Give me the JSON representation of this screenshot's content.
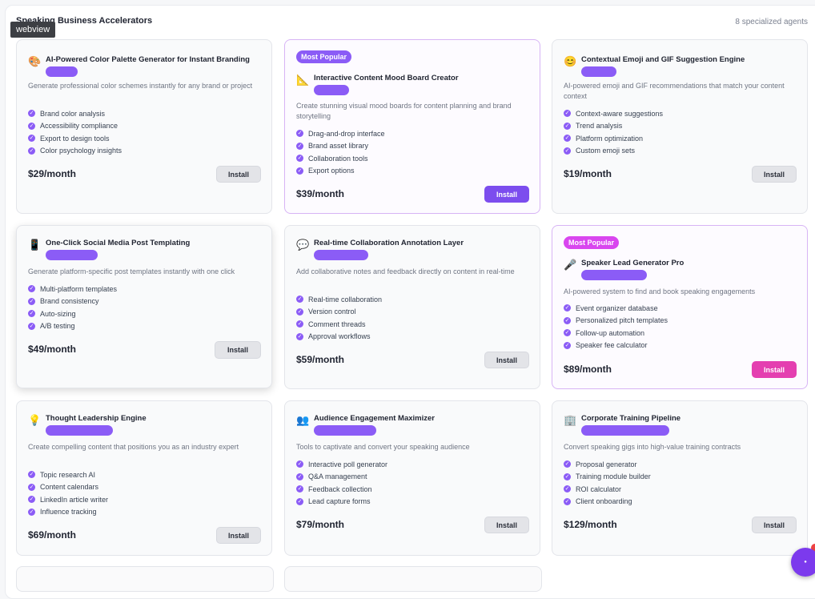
{
  "section": {
    "title": "Speaking Business Accelerators",
    "count": "8 specialized agents"
  },
  "webview_label": "webview",
  "badge_text": "Most Popular",
  "install_label": "Install",
  "colors": {
    "accent": "#8b5cf6",
    "pink": "#e43fb0",
    "purple_button": "#7c4dee"
  },
  "cards": [
    {
      "title": "AI-Powered Color Palette Generator for Instant Branding",
      "icon": "palette-icon",
      "glyph": "🎨",
      "desc": "Generate professional color schemes instantly for any brand or project",
      "features": [
        "Brand color analysis",
        "Accessibility compliance",
        "Export to design tools",
        "Color psychology insights"
      ],
      "price": "$29/month"
    },
    {
      "title": "Interactive Content Mood Board Creator",
      "icon": "triangle-ruler-icon",
      "glyph": "📐",
      "desc": "Create stunning visual mood boards for content planning and brand storytelling",
      "features": [
        "Drag-and-drop interface",
        "Brand asset library",
        "Collaboration tools",
        "Export options"
      ],
      "price": "$39/month"
    },
    {
      "title": "Contextual Emoji and GIF Suggestion Engine",
      "icon": "smiley-icon",
      "glyph": "😊",
      "desc": "AI-powered emoji and GIF recommendations that match your content context",
      "features": [
        "Context-aware suggestions",
        "Trend analysis",
        "Platform optimization",
        "Custom emoji sets"
      ],
      "price": "$19/month"
    },
    {
      "title": "One-Click Social Media Post Templating",
      "icon": "phone-icon",
      "glyph": "📱",
      "desc": "Generate platform-specific post templates instantly with one click",
      "features": [
        "Multi-platform templates",
        "Brand consistency",
        "Auto-sizing",
        "A/B testing"
      ],
      "price": "$49/month"
    },
    {
      "title": "Real-time Collaboration Annotation Layer",
      "icon": "speech-bubble-icon",
      "glyph": "💬",
      "desc": "Add collaborative notes and feedback directly on content in real-time",
      "features": [
        "Real-time collaboration",
        "Version control",
        "Comment threads",
        "Approval workflows"
      ],
      "price": "$59/month"
    },
    {
      "title": "Speaker Lead Generator Pro",
      "icon": "microphone-icon",
      "glyph": "🎤",
      "desc": "AI-powered system to find and book speaking engagements",
      "features": [
        "Event organizer database",
        "Personalized pitch templates",
        "Follow-up automation",
        "Speaker fee calculator"
      ],
      "price": "$89/month"
    },
    {
      "title": "Thought Leadership Engine",
      "icon": "lightbulb-icon",
      "glyph": "💡",
      "desc": "Create compelling content that positions you as an industry expert",
      "features": [
        "Topic research AI",
        "Content calendars",
        "LinkedIn article writer",
        "Influence tracking"
      ],
      "price": "$69/month"
    },
    {
      "title": "Audience Engagement Maximizer",
      "icon": "people-icon",
      "glyph": "👥",
      "desc": "Tools to captivate and convert your speaking audience",
      "features": [
        "Interactive poll generator",
        "Q&A management",
        "Feedback collection",
        "Lead capture forms"
      ],
      "price": "$79/month"
    },
    {
      "title": "Corporate Training Pipeline",
      "icon": "office-building-icon",
      "glyph": "🏢",
      "desc": "Convert speaking gigs into high-value training contracts",
      "features": [
        "Proposal generator",
        "Training module builder",
        "ROI calculator",
        "Client onboarding"
      ],
      "price": "$129/month"
    }
  ]
}
